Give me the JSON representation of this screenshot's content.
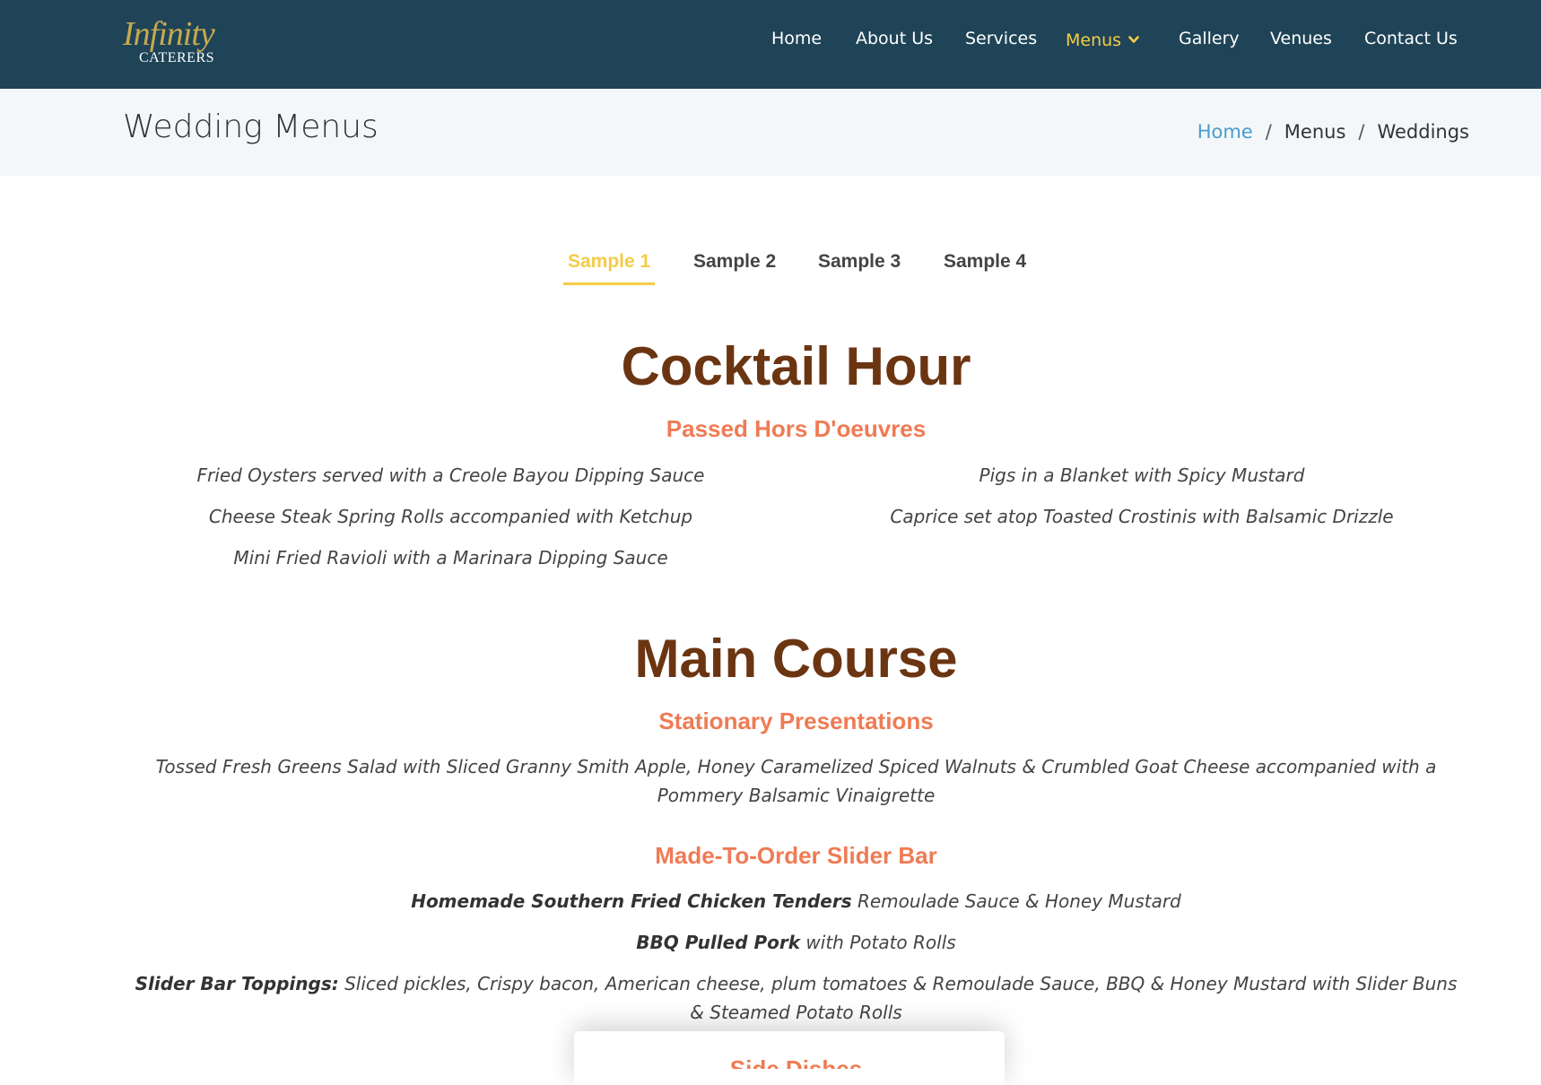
{
  "brand": {
    "logo_script": "Infinity",
    "logo_sub": "CATERERS"
  },
  "nav": {
    "items": [
      "Home",
      "About Us",
      "Services",
      "Menus",
      "Gallery",
      "Venues",
      "Contact Us"
    ],
    "active": "Menus"
  },
  "header": {
    "title": "Wedding Menus",
    "breadcrumb": [
      "Home",
      "Menus",
      "Weddings"
    ]
  },
  "tabs": {
    "items": [
      "Sample 1",
      "Sample 2",
      "Sample 3",
      "Sample 4"
    ],
    "active": "Sample 1"
  },
  "cocktail": {
    "title": "Cocktail Hour",
    "subtitle": "Passed Hors D'oeuvres",
    "left": [
      "Fried Oysters served with a Creole Bayou Dipping Sauce",
      "Cheese Steak Spring Rolls accompanied with Ketchup",
      "Mini Fried Ravioli with a Marinara Dipping Sauce"
    ],
    "right": [
      "Pigs in a Blanket with Spicy Mustard",
      "Caprice set atop Toasted Crostinis with Balsamic Drizzle"
    ]
  },
  "main": {
    "title": "Main Course",
    "stationary_title": "Stationary Presentations",
    "stationary_item": "Tossed Fresh Greens Salad with Sliced Granny Smith Apple, Honey Caramelized Spiced Walnuts & Crumbled Goat Cheese accompanied with a Pommery Balsamic Vinaigrette",
    "slider_title": "Made-To-Order Slider Bar",
    "slider_items": [
      {
        "bold": "Homemade Southern Fried Chicken Tenders",
        "rest": " Remoulade Sauce & Honey Mustard"
      },
      {
        "bold": "BBQ Pulled Pork",
        "rest": " with Potato Rolls"
      },
      {
        "bold": "Slider Bar Toppings:",
        "rest": " Sliced pickles, Crispy bacon, American cheese, plum tomatoes & Remoulade Sauce, BBQ & Honey Mustard with Slider Buns & Steamed Potato Rolls"
      }
    ],
    "next_title": "Side Dishes"
  },
  "colors": {
    "nav_bg": "#1f4457",
    "accent": "#f4cc45",
    "section": "#6b3512",
    "subsection": "#ef7b54",
    "link": "#4a9ccb"
  }
}
